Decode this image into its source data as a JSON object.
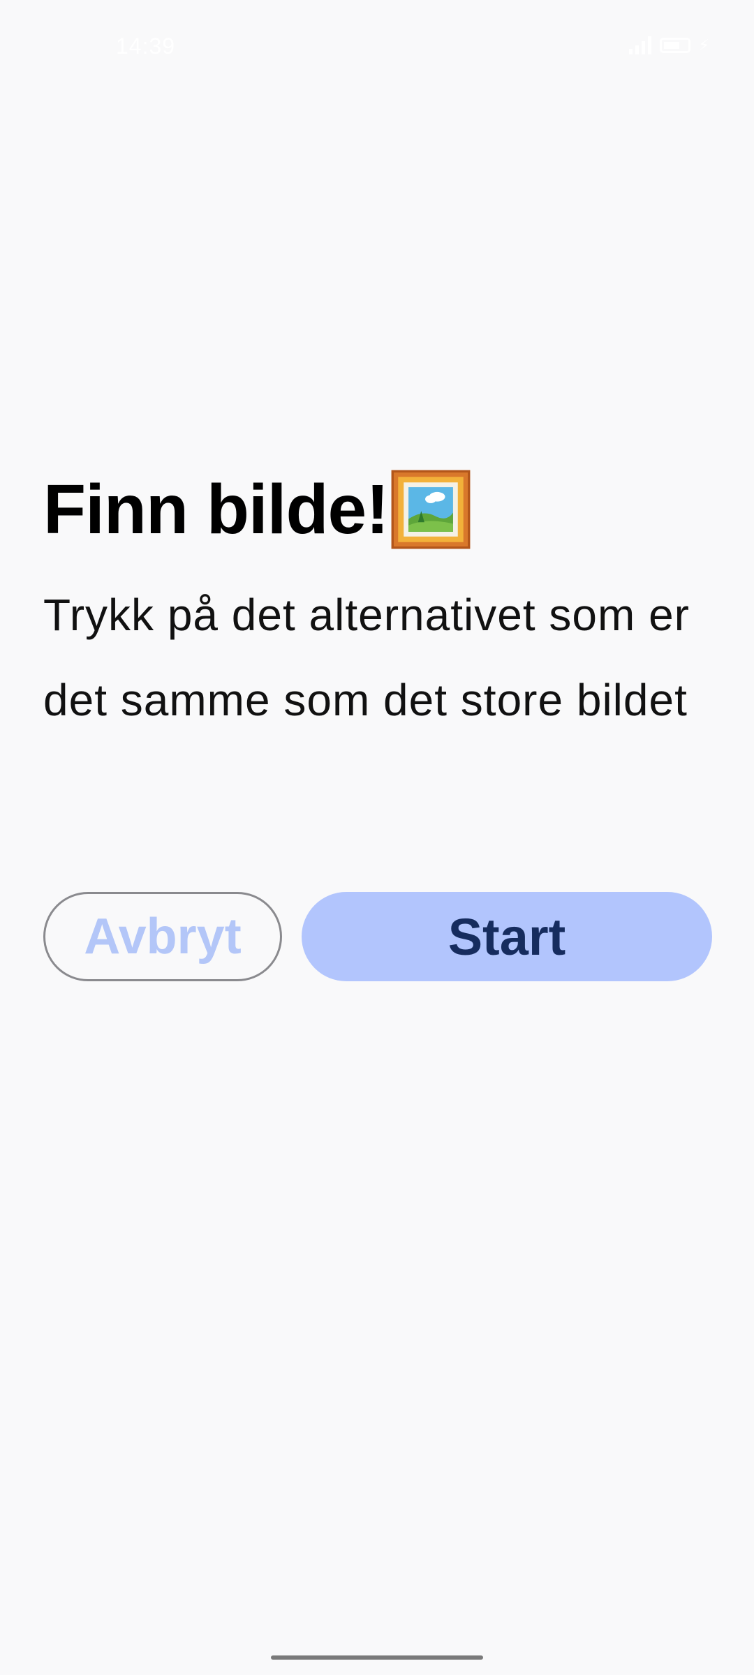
{
  "status_bar": {
    "time": "14:39",
    "icons": [
      "signal-icon",
      "battery-icon",
      "bolt-icon"
    ]
  },
  "screen": {
    "title": "Finn bilde!",
    "title_icon": "framed-picture-icon",
    "instructions": "Trykk på det alternativet som er det samme som det store bildet"
  },
  "buttons": {
    "cancel_label": "Avbryt",
    "start_label": "Start"
  },
  "colors": {
    "background": "#f9f9fa",
    "start_button_bg": "#b2c5fd",
    "start_button_text": "#162c5e",
    "cancel_button_text": "#b3c6f8",
    "cancel_button_border": "#8a8a8e"
  }
}
